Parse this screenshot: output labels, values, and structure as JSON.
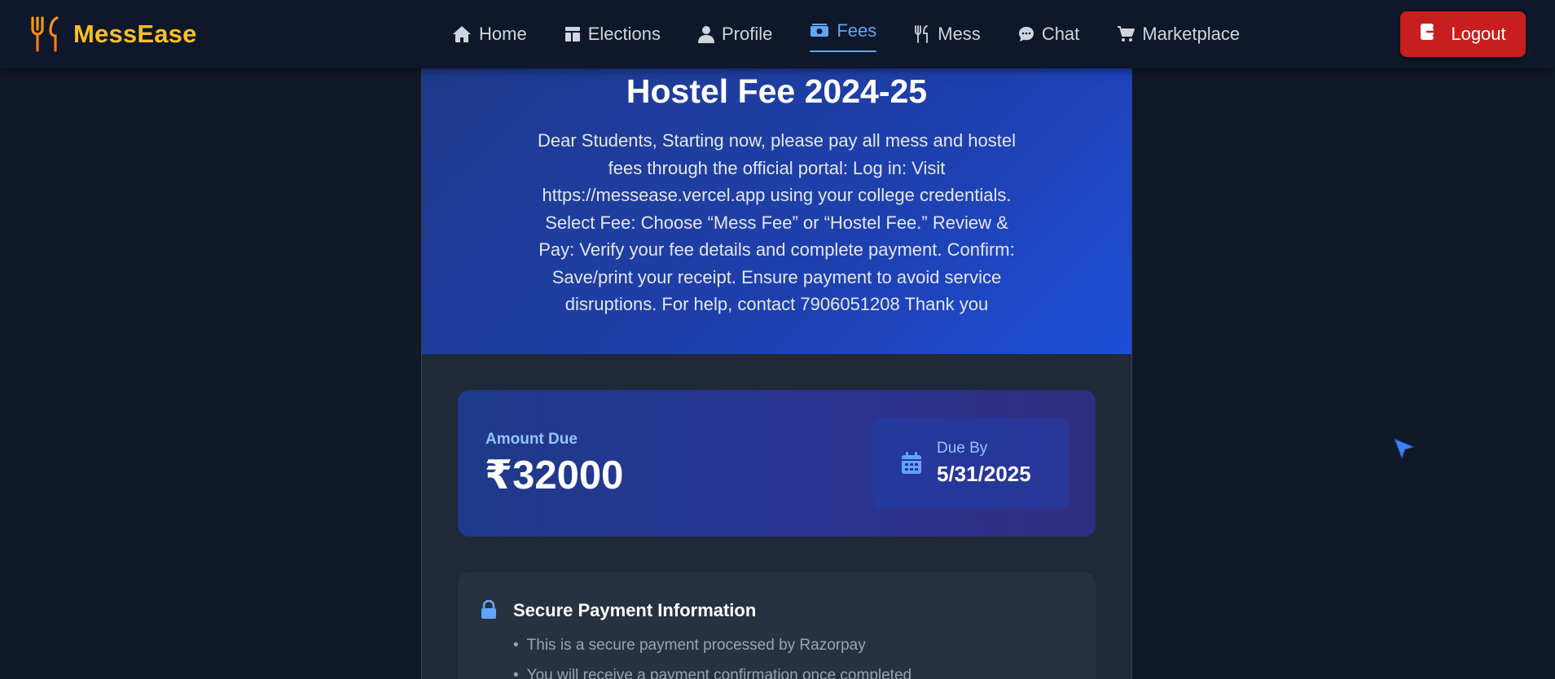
{
  "brand": {
    "name": "MessEase",
    "icon": "fork-knife-icon"
  },
  "nav": {
    "items": [
      {
        "label": "Home",
        "icon": "home-icon"
      },
      {
        "label": "Elections",
        "icon": "layout-icon"
      },
      {
        "label": "Profile",
        "icon": "user-icon"
      },
      {
        "label": "Fees",
        "icon": "money-icon",
        "active": true
      },
      {
        "label": "Mess",
        "icon": "utensils-icon"
      },
      {
        "label": "Chat",
        "icon": "chat-bubble-icon"
      },
      {
        "label": "Marketplace",
        "icon": "cart-icon"
      }
    ],
    "logout_label": "Logout"
  },
  "hero": {
    "title": "Hostel Fee 2024-25",
    "description": "Dear Students, Starting now, please pay all mess and hostel fees through the official portal: Log in: Visit https://messease.vercel.app using your college credentials. Select Fee: Choose “Mess Fee” or “Hostel Fee.” Review & Pay: Verify your fee details and complete payment. Confirm: Save/print your receipt. Ensure payment to avoid service disruptions. For help, contact 7906051208 Thank you"
  },
  "amount": {
    "label": "Amount Due",
    "value": "₹32000",
    "due_label": "Due By",
    "due_date": "5/31/2025"
  },
  "secure": {
    "title": "Secure Payment Information",
    "items": [
      "This is a secure payment processed by Razorpay",
      "You will receive a payment confirmation once completed"
    ]
  },
  "colors": {
    "brand": "#fbbf24",
    "accent": "#60a5fa",
    "logout": "#c81e1e",
    "background": "#111827"
  }
}
